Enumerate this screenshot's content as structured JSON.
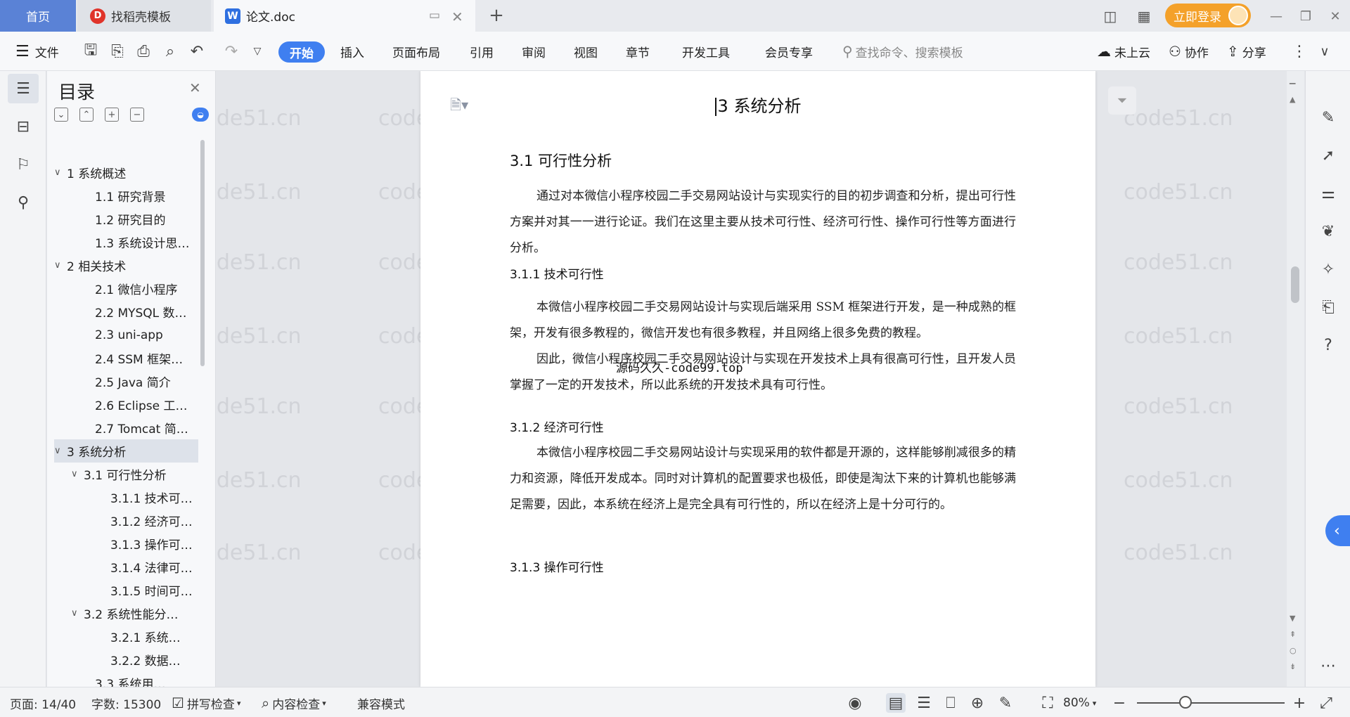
{
  "titlebar": {
    "tabs": [
      {
        "label": "首页"
      },
      {
        "label": "找稻壳模板"
      },
      {
        "label": "论文.doc"
      }
    ],
    "login_label": "立即登录"
  },
  "ribbon": {
    "file_label": "文件",
    "tabs": [
      "开始",
      "插入",
      "页面布局",
      "引用",
      "审阅",
      "视图",
      "章节",
      "开发工具",
      "会员专享"
    ],
    "search_placeholder": "查找命令、搜索模板",
    "cloud_label": "未上云",
    "collab_label": "协作",
    "share_label": "分享"
  },
  "toc": {
    "title": "目录",
    "items": [
      {
        "label": "1 系统概述",
        "level": 1,
        "expanded": true
      },
      {
        "label": "1.1  研究背景",
        "level": 2
      },
      {
        "label": "1.2 研究目的",
        "level": 2
      },
      {
        "label": "1.3 系统设计思…",
        "level": 2
      },
      {
        "label": "2 相关技术",
        "level": 1,
        "expanded": true
      },
      {
        "label": "2.1 微信小程序",
        "level": 2
      },
      {
        "label": "2.2 MYSQL 数…",
        "level": 2
      },
      {
        "label": "2.3 uni-app",
        "level": 2
      },
      {
        "label": "2.4 SSM 框架…",
        "level": 2
      },
      {
        "label": "2.5 Java 简介",
        "level": 2
      },
      {
        "label": "2.6 Eclipse 工…",
        "level": 2
      },
      {
        "label": "2.7 Tomcat 简…",
        "level": 2
      },
      {
        "label": "3 系统分析",
        "level": 1,
        "expanded": true,
        "selected": true
      },
      {
        "label": "3.1 可行性分析",
        "level": 2,
        "expanded": true
      },
      {
        "label": "3.1.1 技术可…",
        "level": 3
      },
      {
        "label": "3.1.2 经济可…",
        "level": 3
      },
      {
        "label": "3.1.3 操作可…",
        "level": 3
      },
      {
        "label": "3.1.4 法律可…",
        "level": 3
      },
      {
        "label": "3.1.5 时间可…",
        "level": 3
      },
      {
        "label": "3.2 系统性能分…",
        "level": 2,
        "expanded": true
      },
      {
        "label": "3.2.1  系统…",
        "level": 3
      },
      {
        "label": "3.2.2  数据…",
        "level": 3
      },
      {
        "label": "3.3 系统用…",
        "level": 2
      }
    ]
  },
  "document": {
    "heading": "3 系统分析",
    "section_31": "3.1 可行性分析",
    "para_1": "通过对本微信小程序校园二手交易网站设计与实现实行的目的初步调查和分析，提出可行性方案并对其一一进行论证。我们在这里主要从技术可行性、经济可行性、操作可行性等方面进行分析。",
    "section_311": "3.1.1 技术可行性",
    "overlay": "源码久久-code99.top",
    "para_2": "本微信小程序校园二手交易网站设计与实现后端采用 SSM 框架进行开发，是一种成熟的框架，开发有很多教程的，微信开发也有很多教程，并且网络上很多免费的教程。",
    "para_3": "因此，微信小程序校园二手交易网站设计与实现在开发技术上具有很高可行性，且开发人员掌握了一定的开发技术，所以此系统的开发技术具有可行性。",
    "section_312": "3.1.2 经济可行性",
    "para_4": "本微信小程序校园二手交易网站设计与实现采用的软件都是开源的，这样能够削减很多的精力和资源，降低开发成本。同时对计算机的配置要求也极低，即使是淘汰下来的计算机也能够满足需要，因此，本系统在经济上是完全具有可行性的，所以在经济上是十分可行的。",
    "section_313": "3.1.3 操作可行性",
    "watermark": "code51.cn"
  },
  "status": {
    "page": "页面: 14/40",
    "words": "字数: 15300",
    "spellcheck": "拼写检查",
    "content_check": "内容检查",
    "compat": "兼容模式",
    "zoom": "80%",
    "zoom_fraction": 0.33
  },
  "colors": {
    "accent": "#3f7ff0",
    "home_tab": "#5a82d6",
    "login": "#f4a12a"
  }
}
